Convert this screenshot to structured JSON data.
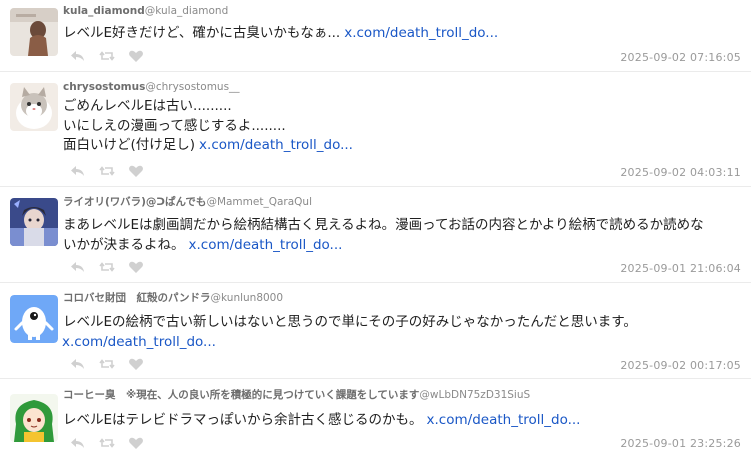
{
  "tweets": [
    {
      "display_name": "kula_diamond",
      "handle": "@kula_diamond",
      "lines": [
        "レベルE好きだけど、確かに古臭いかもなぁ..."
      ],
      "link": "x.com/death_troll_do...",
      "timestamp": "2025-09-02 07:16:05"
    },
    {
      "display_name": "chrysostomus",
      "handle": "@chrysostomus__",
      "lines": [
        "ごめんレベルEは古い.........",
        "いにしえの漫画って感じするよ........",
        "面白いけど(付け足し)"
      ],
      "link": "x.com/death_troll_do...",
      "timestamp": "2025-09-02 04:03:11"
    },
    {
      "display_name": "ライオリ(ワバラ)@ᑐぱんでも",
      "handle": "@Mammet_QaraQul",
      "lines": [
        "まあレベルEは劇画調だから絵柄結構古く見えるよね。漫画ってお話の内容とかより絵柄で読めるか読めな",
        "いかが決まるよね。"
      ],
      "link": "x.com/death_troll_do...",
      "timestamp": "2025-09-01 21:06:04"
    },
    {
      "display_name": "コロバセ財団　紅殻のパンドラ",
      "handle": "@kunlun8000",
      "lines": [
        "レベルEの絵柄で古い新しいはないと思うので単にその子の好みじゃなかったんだと思います。"
      ],
      "link": "x.com/death_troll_do...",
      "timestamp": "2025-09-02 00:17:05"
    },
    {
      "display_name": "コーヒー臭　※現在、人の良い所を積極的に見つけていく課題をしています",
      "handle": "@wLbDN75zD31SiuS",
      "lines": [
        "レベルEはテレビドラマっぽいから余計古く感じるのかも。"
      ],
      "link": "x.com/death_troll_do...",
      "timestamp": "2025-09-01 23:25:26"
    }
  ],
  "icons": {
    "reply": "reply-icon",
    "retweet": "retweet-icon",
    "like": "heart-icon"
  },
  "colors": {
    "link": "#1a57c6",
    "meta": "#9a9a9a",
    "icon": "#d0d0d0",
    "divider": "#ebebeb"
  }
}
